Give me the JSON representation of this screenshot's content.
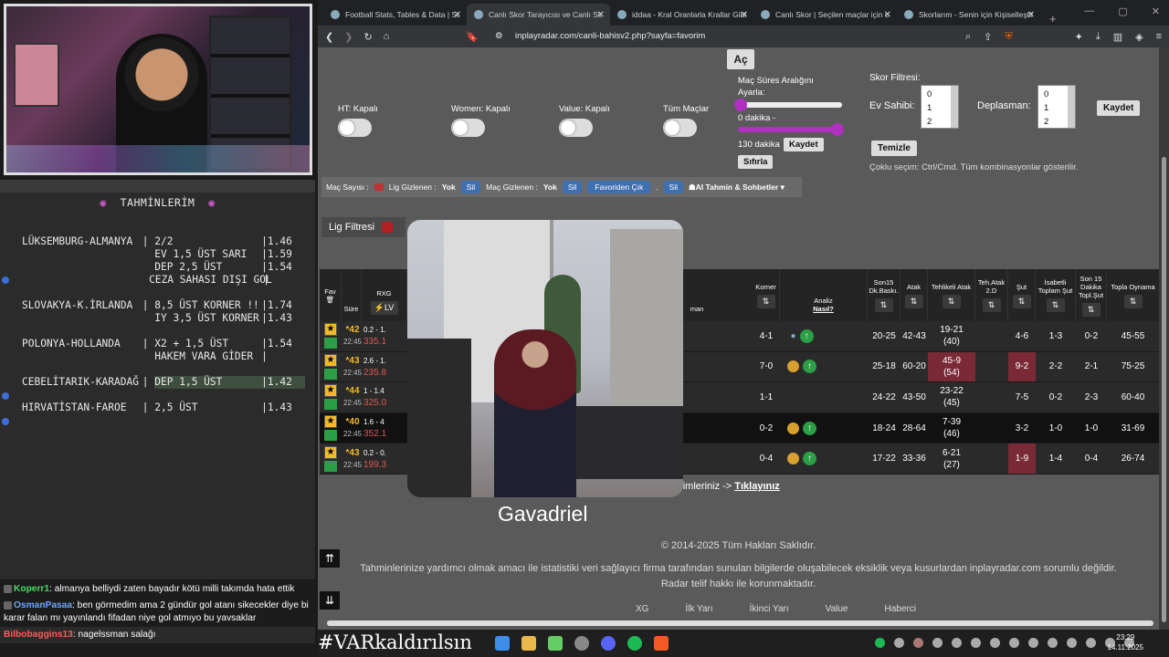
{
  "stream": {
    "predictions_title": "TAHMİNLERİM",
    "predictions": [
      {
        "lines": [
          {
            "match": "LÜKSEMBURG-ALMANYA",
            "pick": "2/2",
            "odds": "1.46"
          },
          {
            "match": "",
            "pick": "EV 1,5 ÜST SARI",
            "odds": "1.59"
          },
          {
            "match": "",
            "pick": "DEP 2,5 ÜST",
            "odds": "1.54"
          },
          {
            "match": "",
            "pick": "CEZA SAHASI DIŞI GOL",
            "odds": ""
          }
        ]
      },
      {
        "lines": [
          {
            "match": "SLOVAKYA-K.İRLANDA",
            "pick": "8,5 ÜST KORNER !!",
            "odds": "1.74"
          },
          {
            "match": "",
            "pick": "IY 3,5 ÜST KORNER",
            "odds": "1.43"
          }
        ]
      },
      {
        "lines": [
          {
            "match": "POLONYA-HOLLANDA",
            "pick": "X2 + 1,5 ÜST",
            "odds": "1.54"
          },
          {
            "match": "",
            "pick": "HAKEM VARA GİDER",
            "odds": ""
          }
        ]
      },
      {
        "lines": [
          {
            "match": "CEBELİTARIK-KARADAĞ",
            "pick": "DEP 1,5 ÜST",
            "odds": "1.42"
          }
        ]
      },
      {
        "lines": [
          {
            "match": "HIRVATİSTAN-FAROE",
            "pick": "2,5 ÜST",
            "odds": "1.43"
          }
        ]
      }
    ],
    "chat": [
      {
        "user": "Koperr1",
        "color": "#4cd964",
        "text": ": almanya belliydi zaten bayadır kötü milli takımda hata ettik"
      },
      {
        "user": "OsmanPasaa",
        "color": "#6aa8ff",
        "text": ": ben görmedim ama 2 gündür gol atanı sikecekler diye bi karar falan mı yayınlandı fifadan niye gol atmıyo bu yavsaklar"
      },
      {
        "user": "Bilbobaggins13",
        "color": "#ff5a5a",
        "text": ": nagelssman salağı"
      }
    ],
    "video_name": "Gavadriel",
    "hashtag": "#VARkaldırılsın"
  },
  "browser": {
    "tabs": [
      {
        "label": "Football Stats, Tables & Data | Socc",
        "active": false
      },
      {
        "label": "Canlı Skor Tarayıcısı ve Canlı Sk",
        "active": true
      },
      {
        "label": "iddaa - Kral Oranlarla Krallar Gibi K",
        "active": false
      },
      {
        "label": "Canlı Skor | Seçilen maçlar için canl",
        "active": false
      },
      {
        "label": "Skorlarım - Senin için Kişiselleştirilm",
        "active": false
      }
    ],
    "url": "inplayradar.com/canli-bahisv2.php?sayfa=favorim"
  },
  "page": {
    "ac_button": "Aç",
    "toggles": [
      "HT: Kapalı",
      "Women: Kapalı",
      "Value: Kapalı",
      "Tüm Maçlar"
    ],
    "duration": {
      "title": "Maç Süres Aralığını Ayarla:",
      "min_label": "0 dakika -",
      "max_label": "130 dakika",
      "save": "Kaydet",
      "reset": "Sıfırla",
      "min_value": 0,
      "max_value": 130
    },
    "score_filter": {
      "title": "Skor Filtresi:",
      "home_label": "Ev Sahibi:",
      "away_label": "Deplasman:",
      "options": [
        "0",
        "1",
        "2"
      ],
      "save": "Kaydet",
      "clear": "Temizle",
      "hint": "Çoklu seçim: Ctrl/Cmd. Tüm kombinasyonlar gösterilir."
    },
    "infobar": {
      "count_label": "Maç Sayısı :",
      "league_hidden": "Lig Gizlenen :",
      "league_hidden_val": "Yok",
      "match_hidden": "Maç Gizlenen :",
      "match_hidden_val": "Yok",
      "sil": "Sil",
      "remove_fav": "Favoriden Çık",
      "dot": ".",
      "ai": "AI Tahmin & Sohbetler"
    },
    "league_filter": "Lig Filtresi",
    "table": {
      "headers": {
        "fav": "Fav",
        "sure": "Süre",
        "rxg": "RXG",
        "lv": "LV",
        "away_partial": "man",
        "korner": "Korner",
        "analiz": "Analiz",
        "nasil": "Nasıl?",
        "son15": "Son15 Dk.Baskı.",
        "atak": "Atak",
        "tehlikeli": "Tehlikeli Atak",
        "tehatak": "Teh.Atak 2.D",
        "sut": "Şut",
        "isabetli": "İsabetli Toplam Şut",
        "son15sut": "Son 15 Dakika Topl.Şut",
        "topla": "Topla Oynama"
      },
      "rows": [
        {
          "minute": "*42",
          "kick": "22:45",
          "rxg_top": "0.2 - 1.",
          "rxg_val": "335.1",
          "korner": "4-1",
          "son15": "20-25",
          "atak": "42-43",
          "tehlikeli": "19-21",
          "tehlikeli_sub": "(40)",
          "tehlikeli_red": false,
          "sut": "4-6",
          "sut_red": false,
          "isabetli": "1-3",
          "son15sut": "0-2",
          "topla": "45-55",
          "dark": false
        },
        {
          "minute": "*43",
          "kick": "22:45",
          "rxg_top": "2.6 - 1.",
          "rxg_val": "235.8",
          "korner": "7-0",
          "son15": "25-18",
          "atak": "60-20",
          "tehlikeli": "45-9",
          "tehlikeli_sub": "(54)",
          "tehlikeli_red": true,
          "sut": "9-2",
          "sut_red": true,
          "isabetli": "2-2",
          "son15sut": "2-1",
          "topla": "75-25",
          "dark": false
        },
        {
          "minute": "*44",
          "kick": "22:45",
          "rxg_top": "1 - 1.4",
          "rxg_val": "325.0",
          "korner": "1-1",
          "son15": "24-22",
          "atak": "43-50",
          "tehlikeli": "23-22",
          "tehlikeli_sub": "(45)",
          "tehlikeli_red": false,
          "sut": "7-5",
          "sut_red": false,
          "isabetli": "0-2",
          "son15sut": "2-3",
          "topla": "60-40",
          "dark": false
        },
        {
          "minute": "*40",
          "kick": "22:45",
          "rxg_top": "1.6 - 4",
          "rxg_val": "352.1",
          "korner": "0-2",
          "son15": "18-24",
          "atak": "28-64",
          "tehlikeli": "7-39",
          "tehlikeli_sub": "(46)",
          "tehlikeli_red": false,
          "sut": "3-2",
          "sut_red": false,
          "isabetli": "1-0",
          "son15sut": "1-0",
          "topla": "31-69",
          "dark": true
        },
        {
          "minute": "*43",
          "kick": "22:45",
          "rxg_top": "0.2 - 0.",
          "rxg_val": "199.3",
          "korner": "0-4",
          "son15": "17-22",
          "atak": "33-36",
          "tehlikeli": "6-21",
          "tehlikeli_sub": "(27)",
          "tehlikeli_red": false,
          "sut": "1-9",
          "sut_red": true,
          "isabetli": "1-4",
          "son15sut": "0-4",
          "topla": "26-74",
          "dark": false
        }
      ]
    },
    "fav_note": "vori Seçimleriniz ->",
    "fav_link": "Tıklayınız",
    "footer_copy": "© 2014-2025 Tüm Hakları Saklıdır.",
    "footer_disclaimer": "Tahminlerinize yardımcı olmak amacı ile istatistiki veri sağlayıcı firma tarafından sunulan bilgilerde oluşabilecek eksiklik veya kusurlardan inplayradar.com sorumlu değildir.",
    "footer_rights": "Radar telif hakkı ile korunmaktadır.",
    "footer_nav": [
      "XG",
      "İlk Yarı",
      "İkinci Yarı",
      "Value",
      "Haberci"
    ]
  },
  "taskbar": {
    "time": "23:29",
    "date": "14.11.2025"
  },
  "colors": {
    "accent_purple": "#b030c0",
    "red_cell": "#7a2a36",
    "gold": "#f2b92a",
    "green": "#2c9e45"
  }
}
